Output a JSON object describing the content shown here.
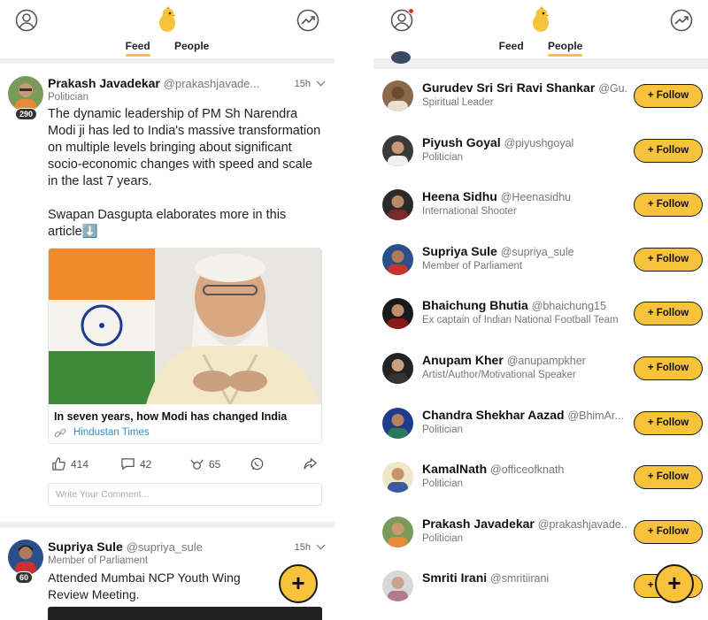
{
  "feed_screen": {
    "tabs": [
      {
        "label": "Feed",
        "active": true
      },
      {
        "label": "People",
        "active": false
      }
    ],
    "posts": [
      {
        "name": "Prakash Javadekar",
        "handle": "@prakashjavade...",
        "role": "Politician",
        "badge": "290",
        "time": "15h",
        "text": "The dynamic leadership of PM Sh Narendra Modi ji has led to India's massive transformation on multiple levels bringing about significant socio-economic changes with speed and scale in the last 7 years.\n\nSwapan Dasgupta elaborates more in this article⬇️",
        "card": {
          "title": "In seven years, how Modi has changed India",
          "source": "Hindustan Times"
        },
        "likes": "414",
        "comments": "42",
        "shares": "65",
        "comment_placeholder": "Write Your Comment..."
      },
      {
        "name": "Supriya Sule",
        "handle": "@supriya_sule",
        "role": "Member of Parliament",
        "badge": "60",
        "time": "15h",
        "text": "Attended Mumbai NCP Youth Wing Review Meeting."
      }
    ],
    "fab": "+"
  },
  "people_screen": {
    "tabs": [
      {
        "label": "Feed",
        "active": false
      },
      {
        "label": "People",
        "active": true
      }
    ],
    "follow_label": "+ Follow",
    "people": [
      {
        "name": "Gurudev Sri Sri Ravi Shankar",
        "handle": "@Gu...",
        "role": "Spiritual Leader"
      },
      {
        "name": "Piyush Goyal",
        "handle": "@piyushgoyal",
        "role": "Politician"
      },
      {
        "name": "Heena Sidhu",
        "handle": "@Heenasidhu",
        "role": "International Shooter"
      },
      {
        "name": "Supriya Sule",
        "handle": "@supriya_sule",
        "role": "Member of Parliament"
      },
      {
        "name": "Bhaichung Bhutia",
        "handle": "@bhaichung15",
        "role": "Ex captain of Indian National Football Team"
      },
      {
        "name": "Anupam Kher",
        "handle": "@anupampkher",
        "role": "Artist/Author/Motivational Speaker"
      },
      {
        "name": "Chandra Shekhar Aazad",
        "handle": "@BhimAr...",
        "role": "Politician"
      },
      {
        "name": "KamalNath",
        "handle": "@officeofknath",
        "role": "Politician"
      },
      {
        "name": "Prakash Javadekar",
        "handle": "@prakashjavade...",
        "role": "Politician"
      },
      {
        "name": "Smriti Irani",
        "handle": "@smritiirani",
        "role": ""
      }
    ],
    "fab": "+"
  },
  "colors": {
    "accent": "#f8c33a",
    "link": "#2c8fd6",
    "notification": "#e2302c"
  }
}
